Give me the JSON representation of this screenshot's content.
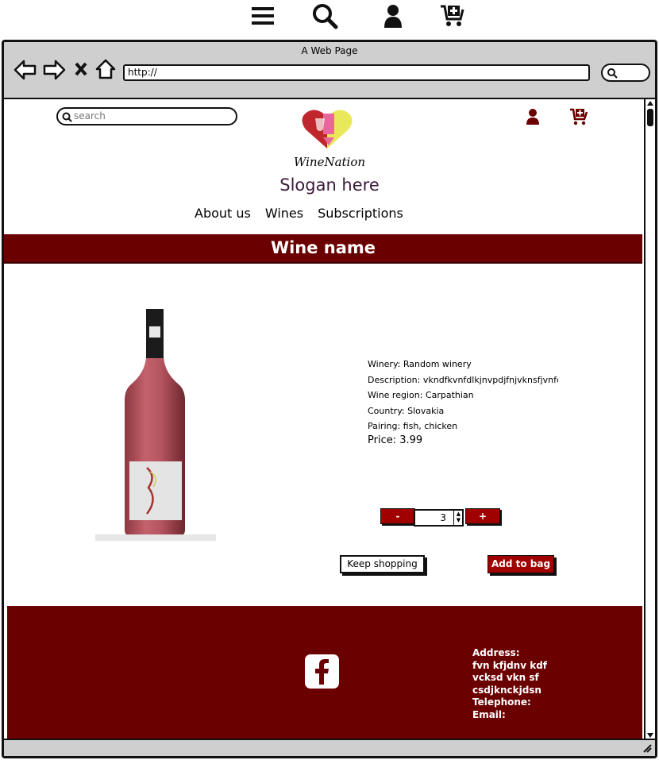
{
  "top_icons": [
    "menu-icon",
    "search-icon",
    "user-icon",
    "cart-add-icon"
  ],
  "browser": {
    "window_title": "A Web Page",
    "url": "http://"
  },
  "site": {
    "search_placeholder": "search",
    "logo_text": "WineNation",
    "slogan": "Slogan here",
    "nav": [
      "About us",
      "Wines",
      "Subscriptions"
    ],
    "banner_title": "Wine name"
  },
  "product": {
    "winery": "Winery: Random winery",
    "description": "Description: vkndfkvnfdlkjnvpdjfnjvknsfjvnfdvd",
    "region": "Wine region: Carpathian",
    "country": "Country: Slovakia",
    "pairing": "Pairing: fish, chicken",
    "price": "Price:  3.99"
  },
  "quantity": {
    "minus_label": "-",
    "plus_label": "+",
    "value": "3"
  },
  "actions": {
    "keep_shopping": "Keep shopping",
    "add_to_bag": "Add to bag"
  },
  "footer": {
    "address_label": "Address:",
    "address_line1": "fvn kfjdnv kdf",
    "address_line2": "vcksd vkn sf",
    "address_line3": "csdjknckjdsn",
    "telephone_label": "Telephone:",
    "email_label": "Email:"
  },
  "colors": {
    "brand": "#6b0000",
    "button_red": "#a00000"
  }
}
